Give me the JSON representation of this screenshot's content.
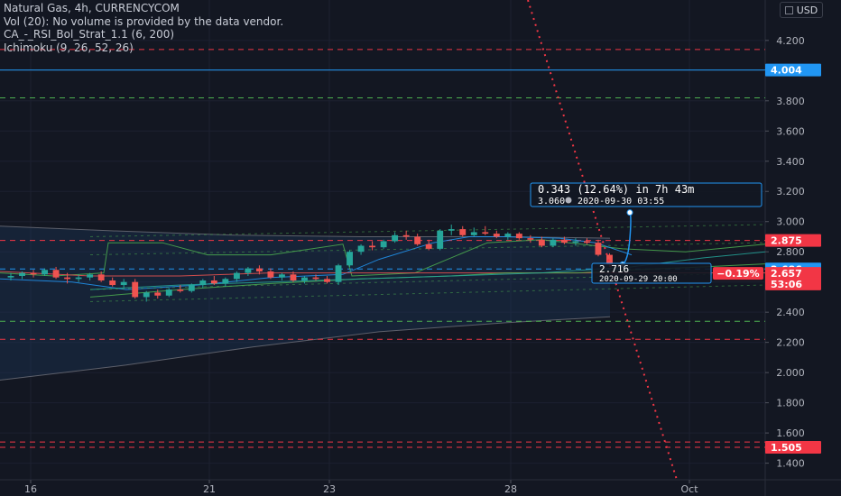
{
  "legend": {
    "symbol": "Natural Gas, 4h, CURRENCYCOM",
    "vol": "Vol (20): No volume is provided by the data vendor.",
    "strategy": "CA_-_RSI_Bol_Strat_1.1 (6, 200)",
    "ichimoku": "Ichimoku (9, 26, 52, 26)"
  },
  "unit_button": "USD",
  "colors": {
    "background": "#131722",
    "up": "#26a69a",
    "down": "#ef5350",
    "blue": "#2196f3",
    "red_line": "#f23645",
    "green_line": "#4caf50",
    "projection": "#2962ff"
  },
  "chart_data": {
    "type": "candlestick",
    "y_ticks": [
      "4.200",
      "4.000",
      "3.800",
      "3.600",
      "3.400",
      "3.200",
      "3.000",
      "2.800",
      "2.600",
      "2.400",
      "2.200",
      "2.000",
      "1.800",
      "1.600",
      "1.400"
    ],
    "x_ticks": [
      "16",
      "21",
      "23",
      "28",
      "Oct"
    ],
    "ylim": [
      1.29,
      4.42
    ],
    "price_tags": [
      {
        "label": "4.004",
        "value": 4.004,
        "color": "#2196f3"
      },
      {
        "label": "2.875",
        "value": 2.875,
        "color": "#f23645"
      },
      {
        "label": "2.686",
        "value": 2.686,
        "color": "#2196f3"
      },
      {
        "label": "2.657",
        "value": 2.657,
        "color": "#f23645"
      },
      {
        "label": "53:06",
        "value": 2.587,
        "color": "#f23645"
      },
      {
        "label": "1.505",
        "value": 1.505,
        "color": "#f23645"
      }
    ],
    "horizontal_levels": [
      {
        "value": 4.004,
        "style": "solid",
        "color": "#2196f3"
      },
      {
        "value": 4.14,
        "style": "dashed",
        "color": "#f23645"
      },
      {
        "value": 3.82,
        "style": "dashed",
        "color": "#4caf50"
      },
      {
        "value": 2.875,
        "style": "dashed",
        "color": "#f23645"
      },
      {
        "value": 2.686,
        "style": "dashed",
        "color": "#2196f3"
      },
      {
        "value": 2.34,
        "style": "dashed",
        "color": "#4caf50"
      },
      {
        "value": 2.22,
        "style": "dashed",
        "color": "#f23645"
      },
      {
        "value": 1.54,
        "style": "dashed",
        "color": "#f23645"
      },
      {
        "value": 1.505,
        "style": "dashed",
        "color": "#f23645"
      }
    ],
    "candles": [
      {
        "o": 2.63,
        "h": 2.66,
        "l": 2.61,
        "c": 2.64
      },
      {
        "o": 2.64,
        "h": 2.67,
        "l": 2.62,
        "c": 2.66
      },
      {
        "o": 2.66,
        "h": 2.68,
        "l": 2.63,
        "c": 2.65
      },
      {
        "o": 2.65,
        "h": 2.69,
        "l": 2.64,
        "c": 2.68
      },
      {
        "o": 2.68,
        "h": 2.7,
        "l": 2.62,
        "c": 2.63
      },
      {
        "o": 2.63,
        "h": 2.66,
        "l": 2.59,
        "c": 2.62
      },
      {
        "o": 2.62,
        "h": 2.65,
        "l": 2.6,
        "c": 2.63
      },
      {
        "o": 2.63,
        "h": 2.66,
        "l": 2.61,
        "c": 2.65
      },
      {
        "o": 2.65,
        "h": 2.67,
        "l": 2.6,
        "c": 2.61
      },
      {
        "o": 2.61,
        "h": 2.63,
        "l": 2.57,
        "c": 2.58
      },
      {
        "o": 2.58,
        "h": 2.62,
        "l": 2.56,
        "c": 2.6
      },
      {
        "o": 2.6,
        "h": 2.62,
        "l": 2.49,
        "c": 2.5
      },
      {
        "o": 2.5,
        "h": 2.54,
        "l": 2.47,
        "c": 2.53
      },
      {
        "o": 2.53,
        "h": 2.55,
        "l": 2.49,
        "c": 2.51
      },
      {
        "o": 2.51,
        "h": 2.56,
        "l": 2.5,
        "c": 2.55
      },
      {
        "o": 2.55,
        "h": 2.58,
        "l": 2.53,
        "c": 2.54
      },
      {
        "o": 2.54,
        "h": 2.59,
        "l": 2.53,
        "c": 2.58
      },
      {
        "o": 2.58,
        "h": 2.62,
        "l": 2.56,
        "c": 2.61
      },
      {
        "o": 2.61,
        "h": 2.64,
        "l": 2.58,
        "c": 2.59
      },
      {
        "o": 2.59,
        "h": 2.63,
        "l": 2.57,
        "c": 2.62
      },
      {
        "o": 2.62,
        "h": 2.67,
        "l": 2.6,
        "c": 2.66
      },
      {
        "o": 2.66,
        "h": 2.7,
        "l": 2.64,
        "c": 2.69
      },
      {
        "o": 2.69,
        "h": 2.71,
        "l": 2.65,
        "c": 2.67
      },
      {
        "o": 2.67,
        "h": 2.69,
        "l": 2.62,
        "c": 2.63
      },
      {
        "o": 2.63,
        "h": 2.66,
        "l": 2.61,
        "c": 2.65
      },
      {
        "o": 2.65,
        "h": 2.67,
        "l": 2.6,
        "c": 2.61
      },
      {
        "o": 2.61,
        "h": 2.64,
        "l": 2.59,
        "c": 2.63
      },
      {
        "o": 2.63,
        "h": 2.65,
        "l": 2.61,
        "c": 2.62
      },
      {
        "o": 2.62,
        "h": 2.64,
        "l": 2.59,
        "c": 2.6
      },
      {
        "o": 2.6,
        "h": 2.72,
        "l": 2.58,
        "c": 2.71
      },
      {
        "o": 2.71,
        "h": 2.81,
        "l": 2.7,
        "c": 2.8
      },
      {
        "o": 2.8,
        "h": 2.85,
        "l": 2.78,
        "c": 2.84
      },
      {
        "o": 2.84,
        "h": 2.87,
        "l": 2.81,
        "c": 2.83
      },
      {
        "o": 2.83,
        "h": 2.88,
        "l": 2.82,
        "c": 2.87
      },
      {
        "o": 2.87,
        "h": 2.93,
        "l": 2.86,
        "c": 2.91
      },
      {
        "o": 2.91,
        "h": 2.94,
        "l": 2.88,
        "c": 2.9
      },
      {
        "o": 2.9,
        "h": 2.92,
        "l": 2.84,
        "c": 2.85
      },
      {
        "o": 2.85,
        "h": 2.88,
        "l": 2.81,
        "c": 2.82
      },
      {
        "o": 2.82,
        "h": 2.95,
        "l": 2.81,
        "c": 2.94
      },
      {
        "o": 2.94,
        "h": 2.98,
        "l": 2.91,
        "c": 2.95
      },
      {
        "o": 2.95,
        "h": 2.97,
        "l": 2.9,
        "c": 2.91
      },
      {
        "o": 2.91,
        "h": 2.96,
        "l": 2.9,
        "c": 2.93
      },
      {
        "o": 2.93,
        "h": 2.97,
        "l": 2.91,
        "c": 2.92
      },
      {
        "o": 2.92,
        "h": 2.94,
        "l": 2.89,
        "c": 2.9
      },
      {
        "o": 2.9,
        "h": 2.93,
        "l": 2.88,
        "c": 2.92
      },
      {
        "o": 2.92,
        "h": 2.93,
        "l": 2.88,
        "c": 2.89
      },
      {
        "o": 2.89,
        "h": 2.91,
        "l": 2.86,
        "c": 2.88
      },
      {
        "o": 2.88,
        "h": 2.9,
        "l": 2.83,
        "c": 2.84
      },
      {
        "o": 2.84,
        "h": 2.89,
        "l": 2.83,
        "c": 2.88
      },
      {
        "o": 2.88,
        "h": 2.9,
        "l": 2.85,
        "c": 2.86
      },
      {
        "o": 2.86,
        "h": 2.89,
        "l": 2.84,
        "c": 2.87
      },
      {
        "o": 2.87,
        "h": 2.89,
        "l": 2.85,
        "c": 2.86
      },
      {
        "o": 2.86,
        "h": 2.88,
        "l": 2.77,
        "c": 2.78
      },
      {
        "o": 2.78,
        "h": 2.79,
        "l": 2.7,
        "c": 2.716
      },
      {
        "o": 2.716,
        "h": 2.72,
        "l": 2.68,
        "c": 2.7
      }
    ],
    "projection": {
      "change": "0.343 (12.64%) in 7h 43m",
      "target": "3.060",
      "target_time": "2020-09-30  03:55",
      "current": "2.716",
      "current_time": "2020-09-29 20:00",
      "change_pct": "−0.19%"
    }
  }
}
